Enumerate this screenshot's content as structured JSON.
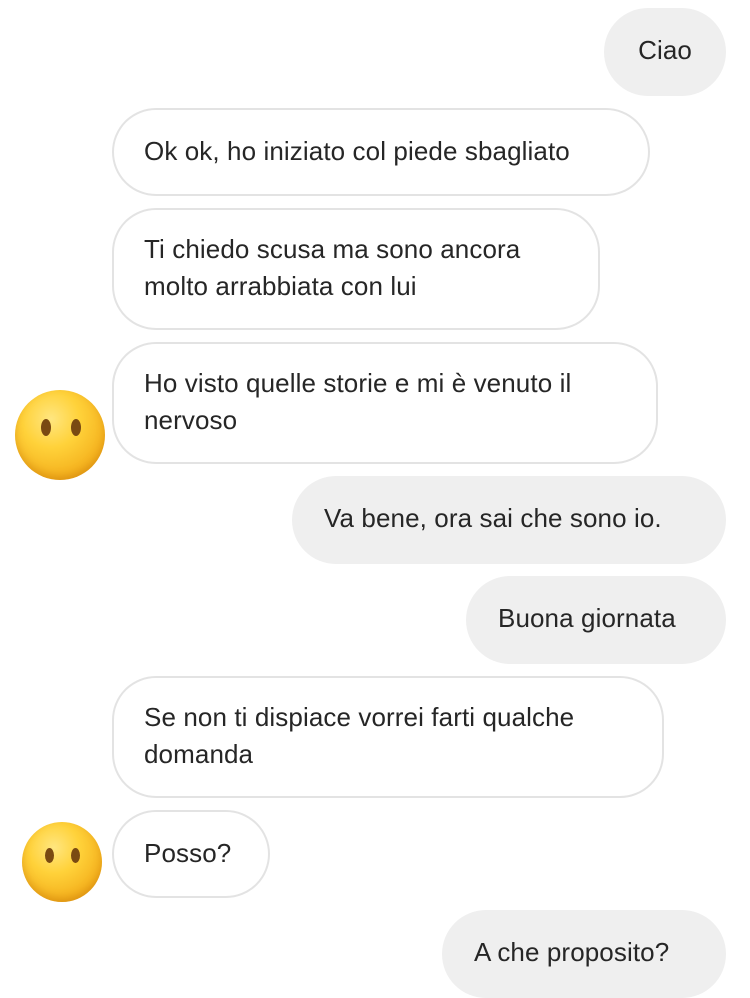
{
  "messages": [
    {
      "side": "sent",
      "text": "Ciao"
    },
    {
      "side": "received",
      "text": "Ok ok, ho iniziato col piede sbagliato"
    },
    {
      "side": "received",
      "text": "Ti chiedo scusa ma sono ancora molto arrabbiata con lui"
    },
    {
      "side": "received",
      "text": "Ho visto quelle storie e mi è venuto il nervoso"
    },
    {
      "side": "sent",
      "text": "Va bene, ora sai che sono io."
    },
    {
      "side": "sent",
      "text": "Buona giornata"
    },
    {
      "side": "received",
      "text": "Se non ti dispiace vorrei farti qualche domanda"
    },
    {
      "side": "received",
      "text": "Posso?"
    },
    {
      "side": "sent",
      "text": "A che proposito?"
    }
  ],
  "avatar_icon": "neutral-face-no-mouth-emoji",
  "colors": {
    "sent_bubble": "#efefef",
    "received_border": "#e3e3e3",
    "text": "#262626"
  }
}
